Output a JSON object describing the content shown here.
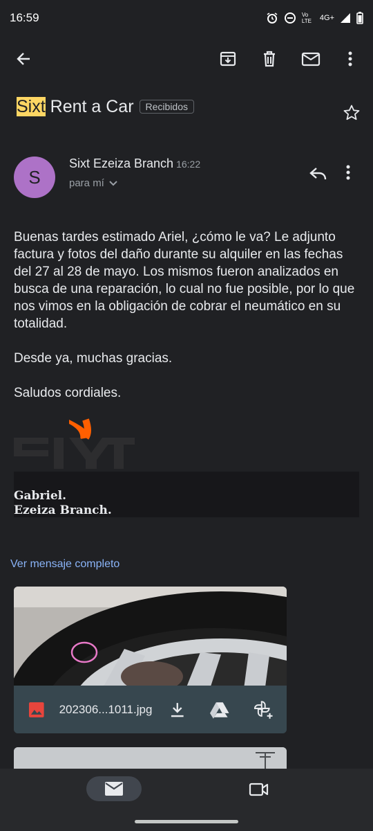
{
  "status": {
    "time": "16:59",
    "network": "4G+",
    "volte": "Vo LTE"
  },
  "toolbar": {
    "back": "back-arrow-icon",
    "archive": "archive-icon",
    "delete": "trash-icon",
    "unread": "mail-icon",
    "more": "more-vert-icon"
  },
  "subject": {
    "highlight": "Sixt",
    "rest": " Rent a Car",
    "label": "Recibidos"
  },
  "message": {
    "avatar_letter": "S",
    "avatar_color": "#ad72c7",
    "sender": "Sixt Ezeiza Branch",
    "time": "16:22",
    "to": "para mí",
    "paragraphs": [
      "Buenas tardes estimado Ariel, ¿cómo le va? Le adjunto factura y fotos del daño durante su alquiler en las fechas del 27 al 28 de mayo. Los mismos fueron analizados en busca de una reparación, lo cual no fue posible, por lo que nos vimos en la obligación de cobrar el neumático en su totalidad.",
      "Desde ya, muchas gracias.",
      "Saludos cordiales."
    ],
    "signature_logo": "sixt",
    "signature_name": "Gabriel.",
    "signature_branch": "Ezeiza Branch."
  },
  "full_message_link": "Ver mensaje completo",
  "attachment": {
    "filename": "202306...1011.jpg"
  },
  "colors": {
    "background": "#202124",
    "link": "#8ab4f8",
    "highlight": "#fdd663",
    "sixt_orange": "#ff5f00"
  }
}
